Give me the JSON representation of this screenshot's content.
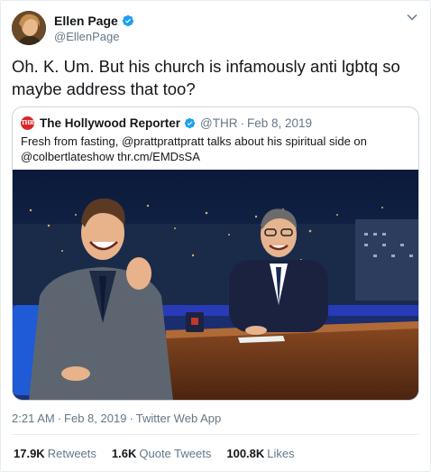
{
  "author": {
    "display_name": "Ellen Page",
    "handle": "@EllenPage",
    "avatar_icon": "profile-photo",
    "verified": true
  },
  "tweet": {
    "text": "Oh. K. Um. But his church is infamously anti lgbtq so maybe address that too?"
  },
  "quoted_tweet": {
    "logo_text": "THR",
    "display_name": "The Hollywood Reporter",
    "handle": "@THR",
    "separator": "·",
    "date": "Feb 8, 2019",
    "text": "Fresh from fasting, @prattprattpratt talks about his spiritual side on @colbertlateshow thr.cm/EMDsSA",
    "image_icon": "late-show-photo"
  },
  "meta": {
    "time": "2:21 AM",
    "separator1": "·",
    "date": "Feb 8, 2019",
    "separator2": "·",
    "source": "Twitter Web App"
  },
  "stats": {
    "retweets_count": "17.9K",
    "retweets_label": "Retweets",
    "quotes_count": "1.6K",
    "quotes_label": "Quote Tweets",
    "likes_count": "100.8K",
    "likes_label": "Likes"
  },
  "colors": {
    "verified": "#1da1f2",
    "secondary_text": "#657786",
    "border": "#ccd6dd",
    "thr_red": "#d8262b"
  }
}
